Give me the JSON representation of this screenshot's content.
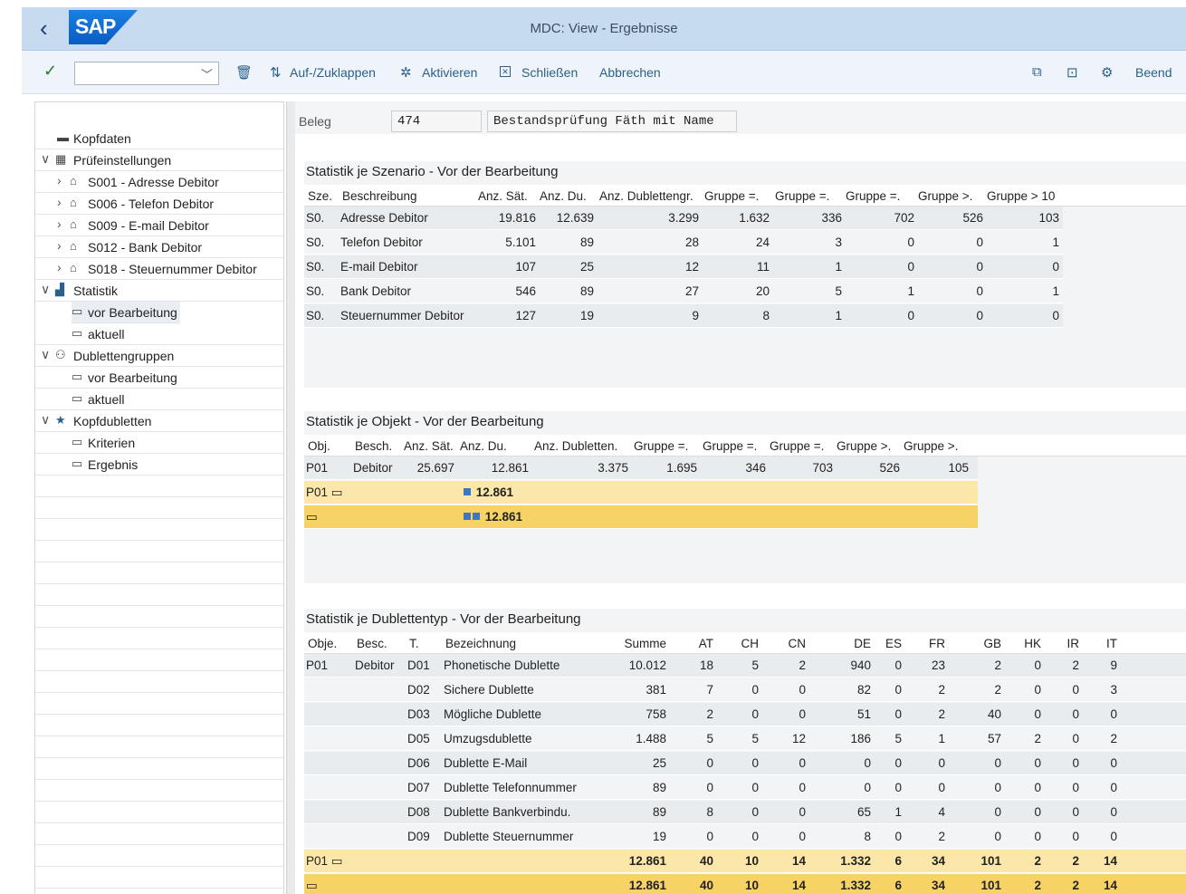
{
  "shell": {
    "back_icon": "‹",
    "logo": "SAP",
    "title": "MDC: View - Ergebnisse"
  },
  "toolbar": {
    "collapse": "Auf-/Zuklappen",
    "activate": "Aktivieren",
    "close": "Schließen",
    "cancel": "Abbrechen",
    "end": "Beend"
  },
  "tree": {
    "kopfdaten": "Kopfdaten",
    "pruef": "Prüfeinstellungen",
    "s001": "S001 - Adresse Debitor",
    "s006": "S006 - Telefon Debitor",
    "s009": "S009 - E-mail Debitor",
    "s012": "S012 - Bank Debitor",
    "s018": "S018 - Steuernummer Debitor",
    "statistik": "Statistik",
    "stat_vor": "vor Bearbeitung",
    "stat_akt": "aktuell",
    "dubgr": "Dublettengruppen",
    "dub_vor": "vor Bearbeitung",
    "dub_akt": "aktuell",
    "kopfdub": "Kopfdubletten",
    "krit": "Kriterien",
    "ergebnis": "Ergebnis"
  },
  "beleg": {
    "label": "Beleg",
    "number": "474",
    "description": "Bestandsprüfung Fäth mit Name"
  },
  "szenario": {
    "title": "Statistik je Szenario - Vor der Bearbeitung",
    "headers": [
      "Sze.",
      "Beschreibung",
      "Anz. Sät.",
      "Anz. Du.",
      "Anz. Dublettengr.",
      "Gruppe =.",
      "Gruppe =.",
      "Gruppe =.",
      "Gruppe >.",
      "Gruppe > 10"
    ],
    "rows": [
      [
        "S0.",
        "Adresse Debitor",
        "19.816",
        "12.639",
        "3.299",
        "1.632",
        "336",
        "702",
        "526",
        "103"
      ],
      [
        "S0.",
        "Telefon Debitor",
        "5.101",
        "89",
        "28",
        "24",
        "3",
        "0",
        "0",
        "1"
      ],
      [
        "S0.",
        "E-mail Debitor",
        "107",
        "25",
        "12",
        "11",
        "1",
        "0",
        "0",
        "0"
      ],
      [
        "S0.",
        "Bank Debitor",
        "546",
        "89",
        "27",
        "20",
        "5",
        "1",
        "0",
        "1"
      ],
      [
        "S0.",
        "Steuernummer Debitor",
        "127",
        "19",
        "9",
        "8",
        "1",
        "0",
        "0",
        "0"
      ]
    ]
  },
  "objekt": {
    "title": "Statistik je Objekt - Vor der Bearbeitung",
    "headers": [
      "Obj.",
      "Besch.",
      "Anz. Sät.",
      "Anz. Du.",
      "Anz. Dubletten.",
      "Gruppe =.",
      "Gruppe =.",
      "Gruppe =.",
      "Gruppe >.",
      "Gruppe >."
    ],
    "row": [
      "P01",
      "Debitor",
      "25.697",
      "12.861",
      "3.375",
      "1.695",
      "346",
      "703",
      "526",
      "105"
    ],
    "sub_label": "P01",
    "sub_value": "12.861",
    "total_value": "12.861"
  },
  "typ": {
    "title": "Statistik je Dublettentyp - Vor der Bearbeitung",
    "headers": [
      "Obje.",
      "Besc.",
      "T.",
      "Bezeichnung",
      "Summe",
      "AT",
      "CH",
      "CN",
      "DE",
      "ES",
      "FR",
      "GB",
      "HK",
      "IR",
      "IT"
    ],
    "obj": "P01",
    "besc": "Debitor",
    "rows": [
      [
        "D01",
        "Phonetische Dublette",
        "10.012",
        "18",
        "5",
        "2",
        "940",
        "0",
        "23",
        "2",
        "0",
        "2",
        "9"
      ],
      [
        "D02",
        "Sichere Dublette",
        "381",
        "7",
        "0",
        "0",
        "82",
        "0",
        "2",
        "2",
        "0",
        "0",
        "3"
      ],
      [
        "D03",
        "Mögliche Dublette",
        "758",
        "2",
        "0",
        "0",
        "51",
        "0",
        "2",
        "40",
        "0",
        "0",
        "0"
      ],
      [
        "D05",
        "Umzugsdublette",
        "1.488",
        "5",
        "5",
        "12",
        "186",
        "5",
        "1",
        "57",
        "2",
        "0",
        "2"
      ],
      [
        "D06",
        "Dublette E-Mail",
        "25",
        "0",
        "0",
        "0",
        "0",
        "0",
        "0",
        "0",
        "0",
        "0",
        "0"
      ],
      [
        "D07",
        "Dublette Telefonnummer",
        "89",
        "0",
        "0",
        "0",
        "0",
        "0",
        "0",
        "0",
        "0",
        "0",
        "0"
      ],
      [
        "D08",
        "Dublette Bankverbindu.",
        "89",
        "8",
        "0",
        "0",
        "65",
        "1",
        "4",
        "0",
        "0",
        "0",
        "0"
      ],
      [
        "D09",
        "Dublette Steuernummer",
        "19",
        "0",
        "0",
        "0",
        "8",
        "0",
        "2",
        "0",
        "0",
        "0",
        "0"
      ]
    ],
    "sub_label": "P01",
    "totals": [
      "12.861",
      "40",
      "10",
      "14",
      "1.332",
      "6",
      "34",
      "101",
      "2",
      "2",
      "14"
    ]
  }
}
